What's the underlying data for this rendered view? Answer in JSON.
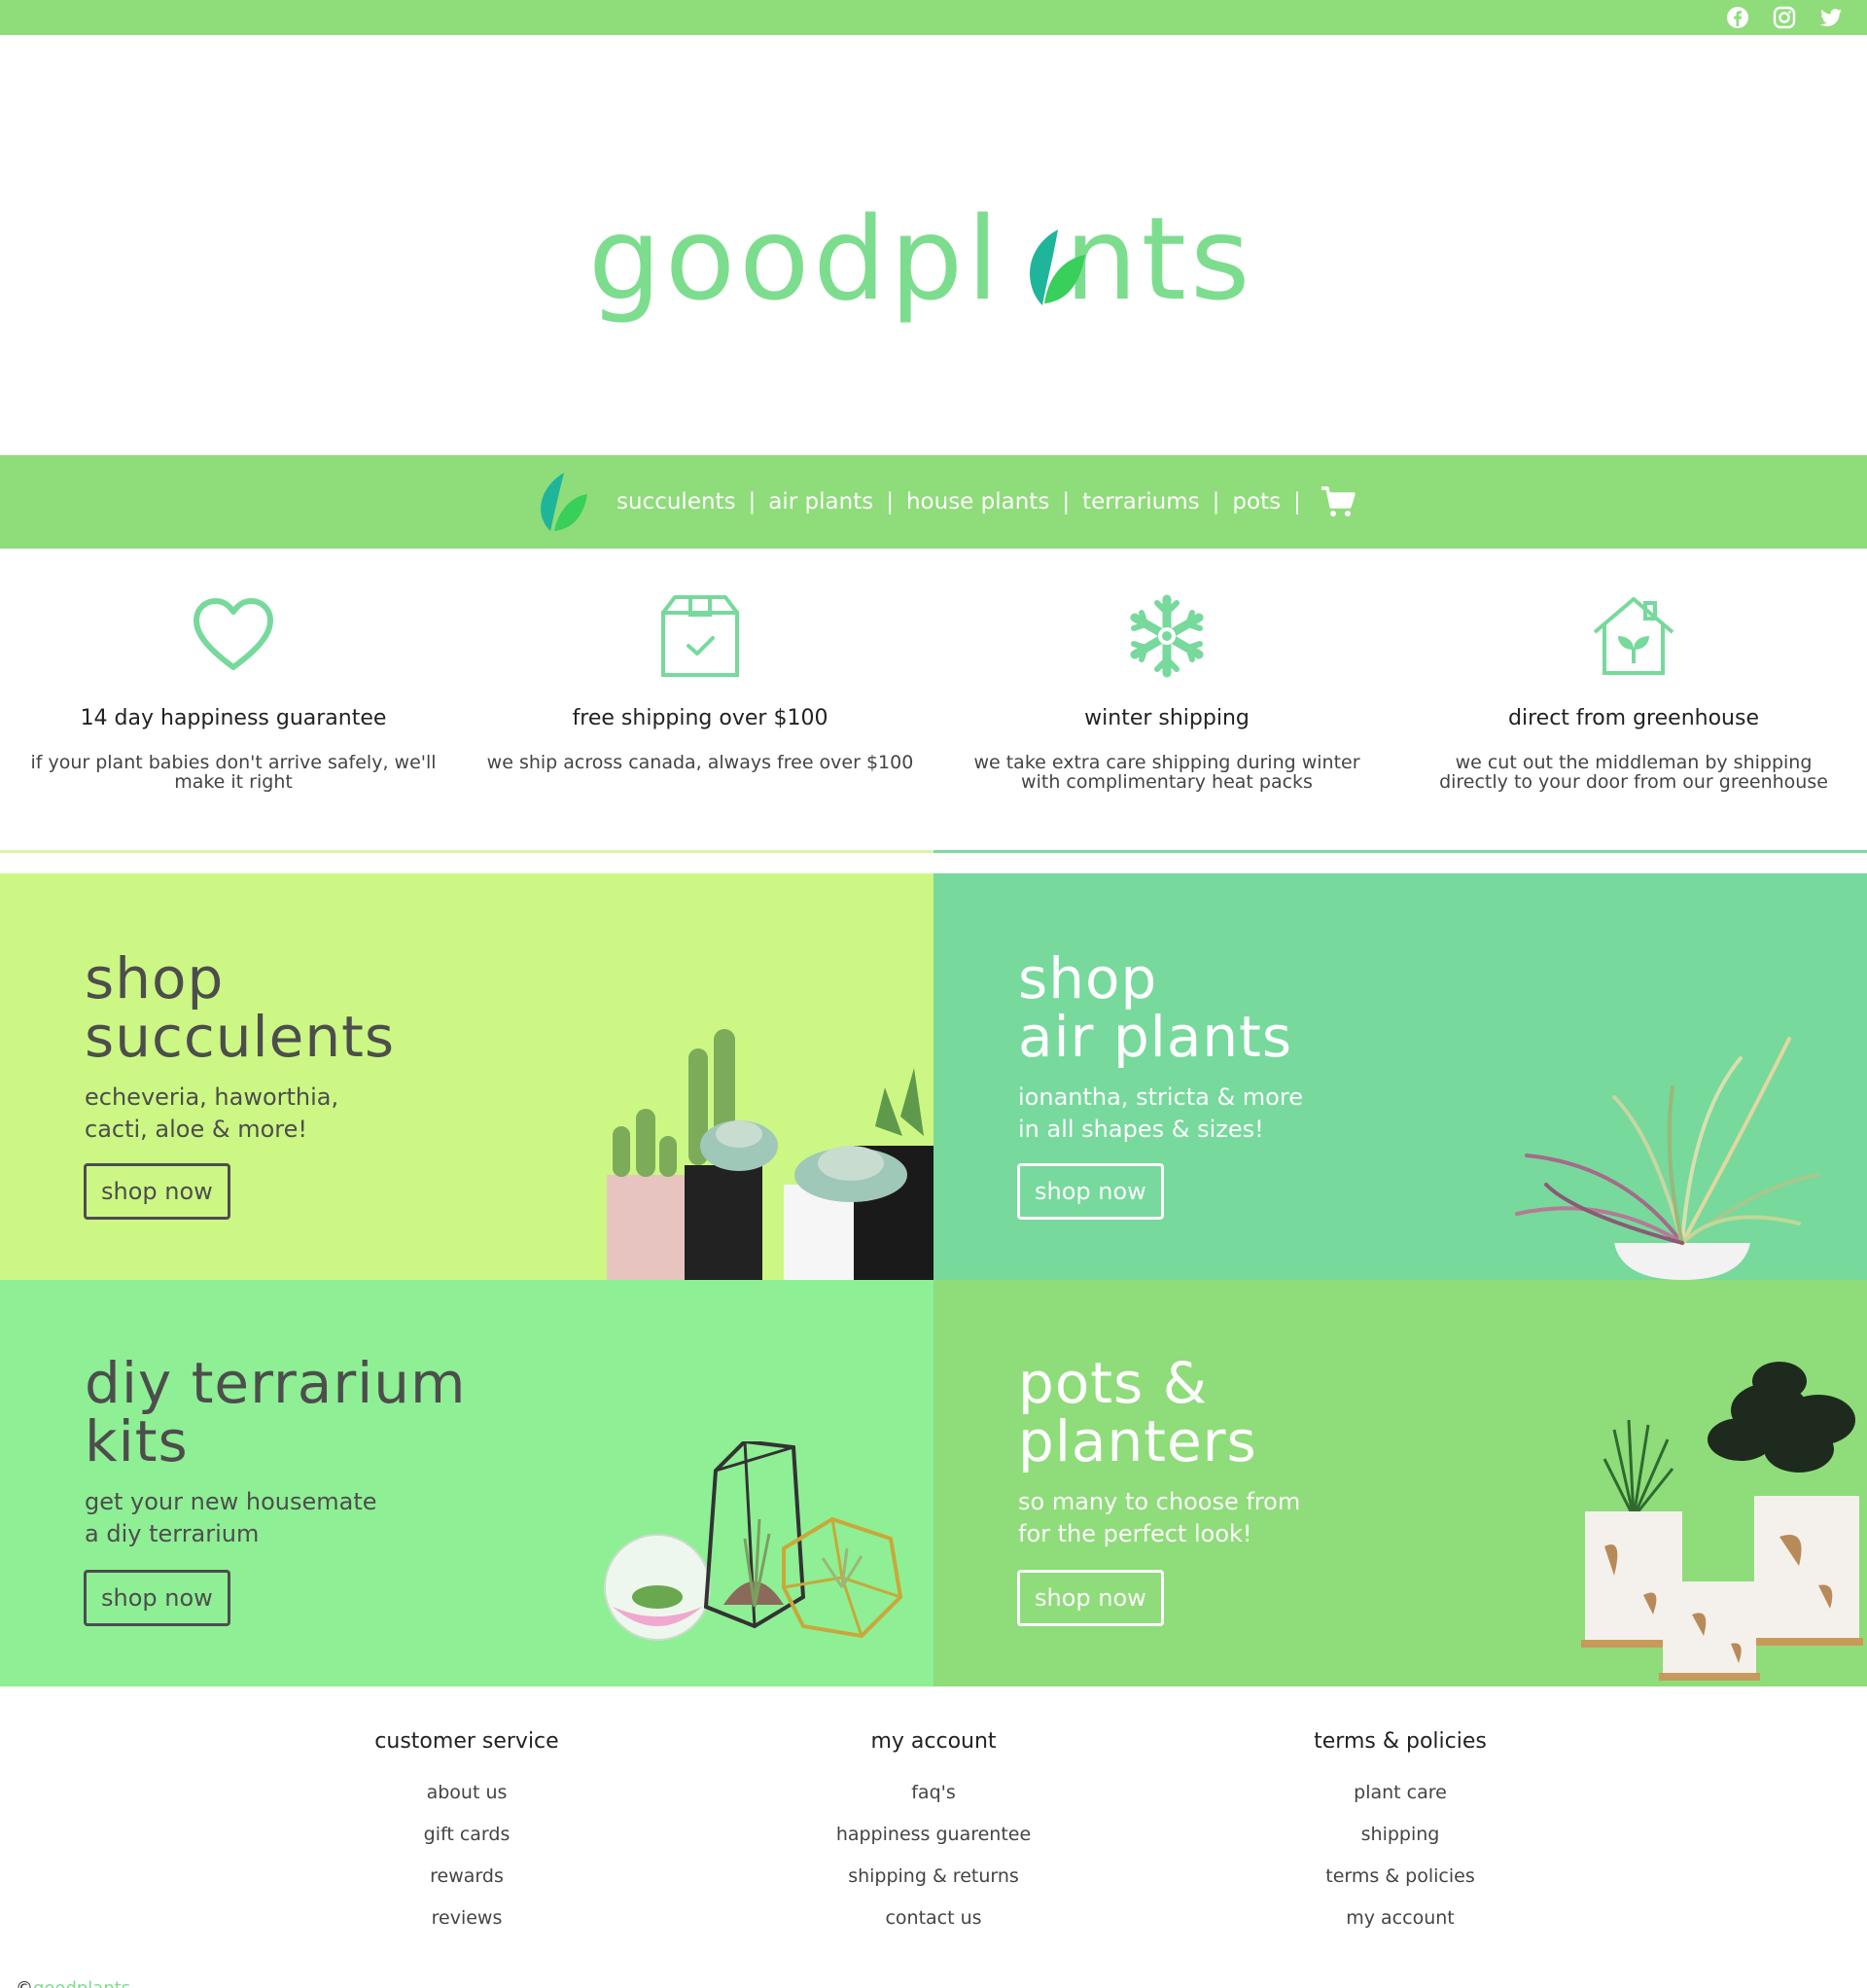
{
  "colors": {
    "brand_green": "#8fdc7a",
    "logo_green": "#7ddd8f",
    "succulents_bg": "#ccf784",
    "air_plants_bg": "#77d99c",
    "terrarium_bg": "#8fef95",
    "pots_bg": "#8fdc7a"
  },
  "social": [
    {
      "icon": "facebook-icon"
    },
    {
      "icon": "instagram-icon"
    },
    {
      "icon": "twitter-icon"
    }
  ],
  "logo": {
    "text": "goodplants"
  },
  "nav": {
    "leaf_icon": "leaf-logo-icon",
    "items": [
      "succulents",
      "air plants",
      "house plants",
      "terrariums",
      "pots"
    ],
    "separator": "|",
    "cart_icon": "shopping-cart-icon"
  },
  "features": [
    {
      "icon": "heart-icon",
      "title": "14 day happiness guarantee",
      "desc": "if your plant babies don't arrive safely, we'll make it right"
    },
    {
      "icon": "box-check-icon",
      "title": "free shipping over $100",
      "desc": "we ship across canada, always free over $100"
    },
    {
      "icon": "snowflake-icon",
      "title": "winter shipping",
      "desc": "we take extra care shipping during winter with complimentary heat packs"
    },
    {
      "icon": "greenhouse-icon",
      "title": "direct from greenhouse",
      "desc": "we cut out the middleman by shipping directly to your door from our greenhouse"
    }
  ],
  "tiles": [
    {
      "title_line1": "shop",
      "title_line2": "succulents",
      "sub_line1": "echeveria, haworthia,",
      "sub_line2": "cacti, aloe & more!",
      "button": "shop now"
    },
    {
      "title_line1": "shop",
      "title_line2": "air plants",
      "sub_line1": "ionantha, stricta & more",
      "sub_line2": "in all shapes & sizes!",
      "button": "shop now"
    },
    {
      "title_line1": "diy terrarium",
      "title_line2": "kits",
      "sub_line1": "get your new housemate",
      "sub_line2": "a diy terrarium",
      "button": "shop now"
    },
    {
      "title_line1": "pots &",
      "title_line2": "planters",
      "sub_line1": "so many to choose from",
      "sub_line2": "for the perfect look!",
      "button": "shop now"
    }
  ],
  "footer": {
    "columns": [
      {
        "heading": "customer service",
        "links": [
          "about us",
          "gift cards",
          "rewards",
          "reviews"
        ]
      },
      {
        "heading": "my account",
        "links": [
          "faq's",
          "happiness guarentee",
          "shipping & returns",
          "contact us"
        ]
      },
      {
        "heading": "terms & policies",
        "links": [
          "plant care",
          "shipping",
          "terms & policies",
          "my account"
        ]
      }
    ],
    "copyright_symbol": "©",
    "copyright_brand": "goodplants"
  }
}
